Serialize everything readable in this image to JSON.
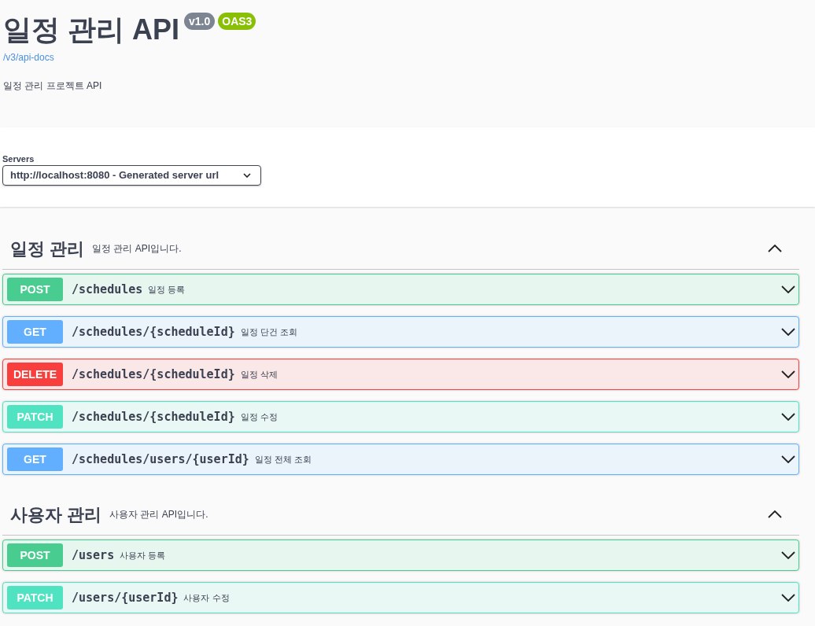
{
  "info": {
    "title": "일정 관리 API",
    "version": "v1.0",
    "oas_badge": "OAS3",
    "spec_link": "/v3/api-docs",
    "description": "일정 관리 프로젝트 API"
  },
  "servers": {
    "label": "Servers",
    "selected_value": "http://localhost:8080 - Generated server url"
  },
  "tags": [
    {
      "name": "일정 관리",
      "description": "일정 관리 API입니다.",
      "expanded": true,
      "operations": [
        {
          "method": "POST",
          "path": "/schedules",
          "summary": "일정 등록"
        },
        {
          "method": "GET",
          "path": "/schedules/{scheduleId}",
          "summary": "일정 단건 조회"
        },
        {
          "method": "DELETE",
          "path": "/schedules/{scheduleId}",
          "summary": "일정 삭제"
        },
        {
          "method": "PATCH",
          "path": "/schedules/{scheduleId}",
          "summary": "일정 수정"
        },
        {
          "method": "GET",
          "path": "/schedules/users/{userId}",
          "summary": "일정 전체 조회"
        }
      ]
    },
    {
      "name": "사용자 관리",
      "description": "사용자 관리 API입니다.",
      "expanded": true,
      "operations": [
        {
          "method": "POST",
          "path": "/users",
          "summary": "사용자 등록"
        },
        {
          "method": "PATCH",
          "path": "/users/{userId}",
          "summary": "사용자 수정"
        }
      ]
    }
  ]
}
